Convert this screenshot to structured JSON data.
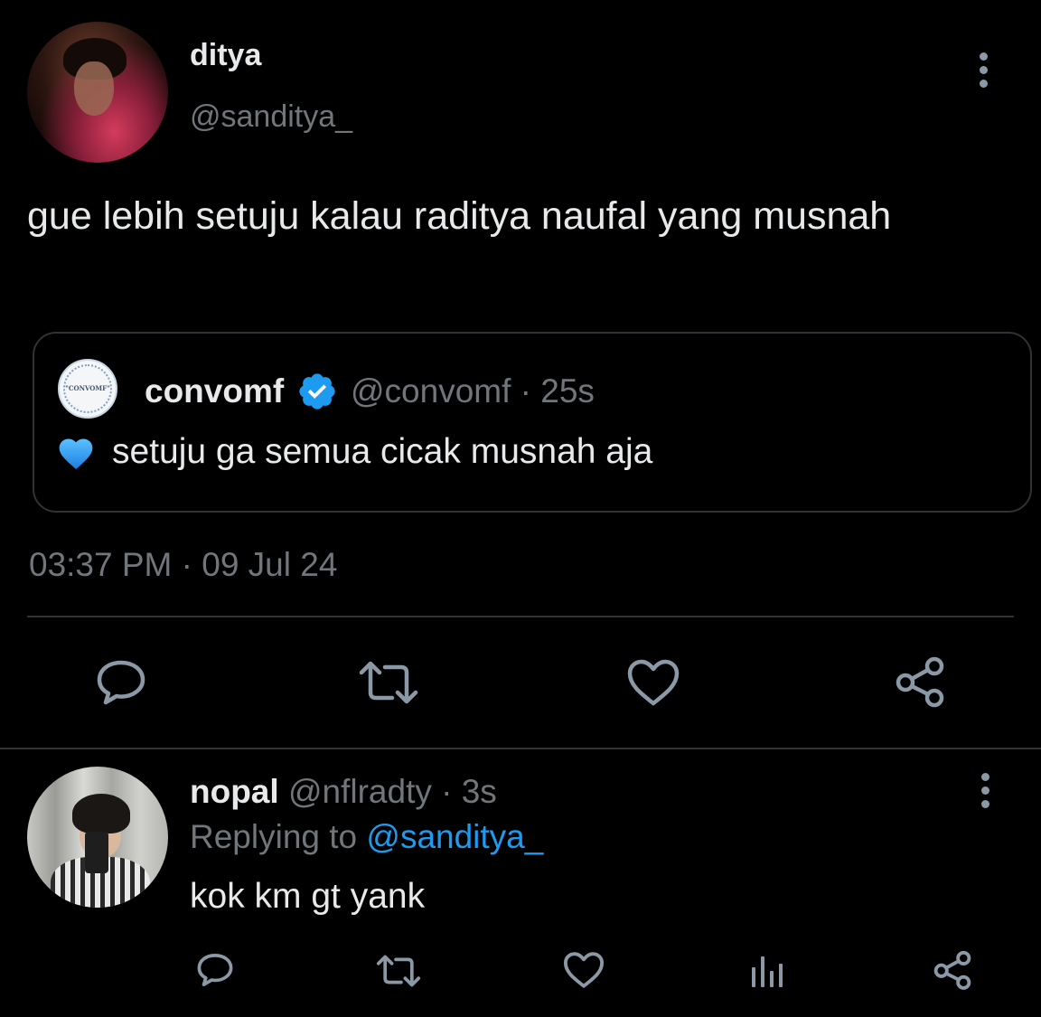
{
  "main_tweet": {
    "display_name": "ditya",
    "handle": "@sanditya_",
    "text": "gue lebih setuju kalau raditya naufal yang musnah",
    "timestamp": "03:37 PM · 09 Jul 24",
    "avatar": "profile-photo"
  },
  "quoted_tweet": {
    "display_name": "convomf",
    "handle_time": "@convomf · 25s",
    "emoji": "blue-heart-icon",
    "text": "setuju ga semua cicak musnah aja",
    "avatar_logo_text": "\"CONVOMF\"",
    "verified_icon": "verified-badge-icon"
  },
  "reply_tweet": {
    "display_name": "nopal",
    "handle_time": " @nflradty · 3s",
    "replying_prefix": "Replying to ",
    "replying_handle": "@sanditya_",
    "text": "kok km gt yank",
    "avatar": "profile-photo"
  },
  "icons": {
    "more": "more-vertical-icon",
    "reply": "reply-icon",
    "retweet": "retweet-icon",
    "like": "like-icon",
    "views": "views-icon",
    "share": "share-icon"
  },
  "colors": {
    "background": "#000000",
    "text_primary": "#e7e9ea",
    "text_secondary": "#71767b",
    "accent": "#1d9bf0",
    "icon": "#8b98a5",
    "divider": "#2f3336"
  }
}
